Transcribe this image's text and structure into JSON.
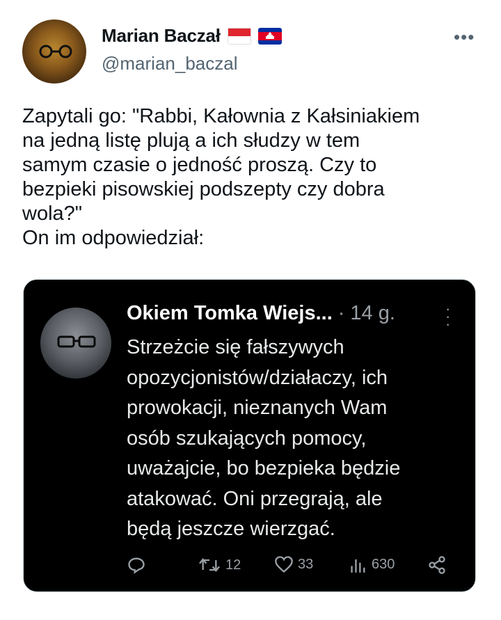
{
  "author": {
    "display_name": "Marian Baczał",
    "handle": "@marian_baczal",
    "avatar_icon": "avatar-mustache-glasses",
    "flags": [
      "indonesia-flag-icon",
      "cambodia-flag-icon"
    ]
  },
  "more_icon": "more-horizontal-icon",
  "tweet_text": "Zapytali go: \"Rabbi, Kałownia z Kałsiniakiem\nna jedną listę plują a ich słudzy w tem\nsamym czasie o jedność proszą. Czy to\nbezpieki pisowskiej podszepty czy dobra\nwola?\"\nOn im odpowiedział:",
  "embedded": {
    "display_name": "Okiem Tomka Wiejs...",
    "separator": "·",
    "time": "14 g.",
    "text": "Strzeżcie się fałszywych\nopozycjonistów/działaczy, ich\nprowokacji, nieznanych Wam\nosób szukających pomocy,\nuważajcie, bo bezpieka będzie\natakować. Oni przegrają, ale\nbędą jeszcze wierzgać.",
    "actions": {
      "reply": {
        "icon": "reply-icon",
        "count": ""
      },
      "retweet": {
        "icon": "retweet-icon",
        "count": "12"
      },
      "like": {
        "icon": "heart-icon",
        "count": "33"
      },
      "views": {
        "icon": "views-icon",
        "count": "630"
      },
      "share": {
        "icon": "share-icon",
        "count": ""
      }
    }
  },
  "colors": {
    "text": "#0f1419",
    "muted": "#536471",
    "embed_bg": "#000000",
    "embed_text": "#e7e9ea"
  }
}
